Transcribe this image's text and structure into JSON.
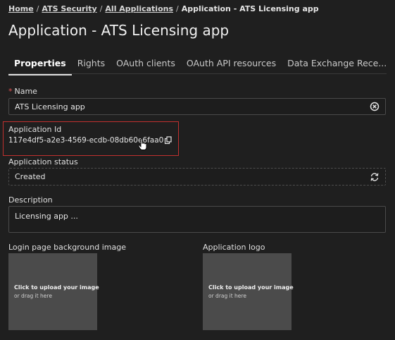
{
  "breadcrumb": {
    "items": [
      "Home",
      "ATS Security",
      "All Applications"
    ],
    "current": "Application - ATS Licensing app"
  },
  "page_title": "Application - ATS Licensing app",
  "tabs": [
    {
      "label": "Properties",
      "active": true
    },
    {
      "label": "Rights"
    },
    {
      "label": "OAuth clients"
    },
    {
      "label": "OAuth API resources"
    },
    {
      "label": "Data Exchange Rece..."
    }
  ],
  "fields": {
    "name": {
      "label": "Name",
      "required": true,
      "value": "ATS Licensing app",
      "icon": "clear-icon"
    },
    "app_id": {
      "label": "Application Id",
      "value": "117e4df5-a2e3-4569-ecdb-08db60e6faa0",
      "icon": "copy-icon"
    },
    "status": {
      "label": "Application status",
      "value": "Created",
      "icon": "refresh-icon"
    },
    "description": {
      "label": "Description",
      "value": "Licensing app ..."
    }
  },
  "uploads": {
    "background": {
      "label": "Login page background image",
      "line1": "Click to upload your image",
      "line2": "or drag it here"
    },
    "logo": {
      "label": "Application logo",
      "line1": "Click to upload your image",
      "line2": "or drag it here"
    }
  },
  "colors": {
    "background": "#1f1f1f",
    "highlight": "#c0312f",
    "upload_bg": "#4b4b4b",
    "required": "#e05050"
  }
}
